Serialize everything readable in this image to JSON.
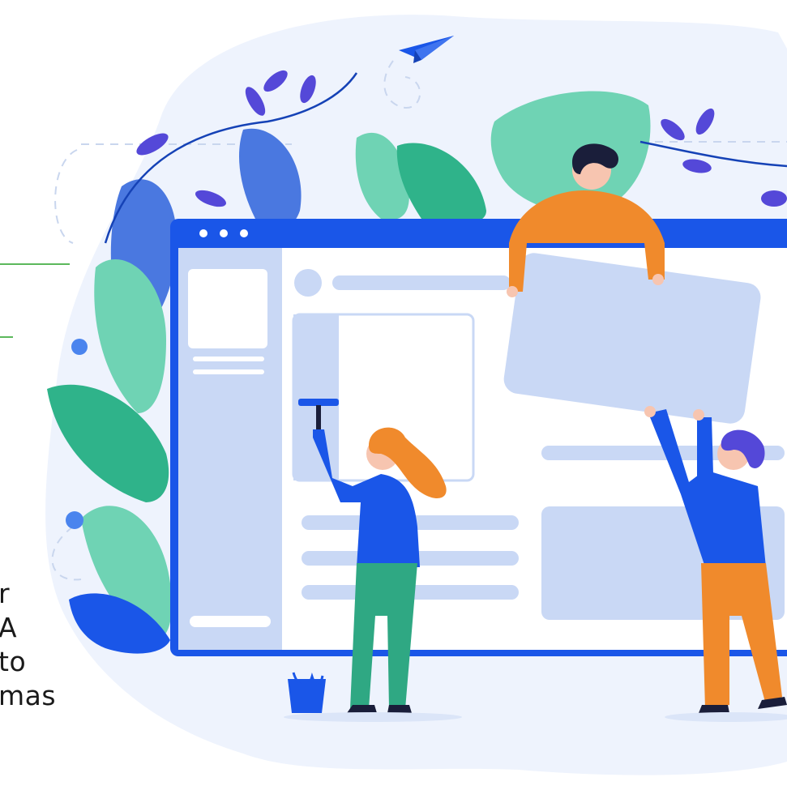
{
  "text_fragments": [
    "r",
    "A",
    "to",
    "mas"
  ],
  "colors": {
    "brand_blue": "#1a56e8",
    "window_panel": "#c9d8f5",
    "background_blob": "#eef3fd",
    "leaf_teal": "#6fd3b4",
    "leaf_green": "#2fb38a",
    "leaf_blue": "#4a78e0",
    "orange": "#f08a2c",
    "accent_green_rule": "#5cb85c"
  },
  "illustration": {
    "window_dots": 3,
    "figures": [
      "person-holding-panel-top",
      "person-painting-roller",
      "person-lifting-panel"
    ],
    "icons": [
      "paper-plane-icon",
      "paint-bucket-icon"
    ]
  }
}
